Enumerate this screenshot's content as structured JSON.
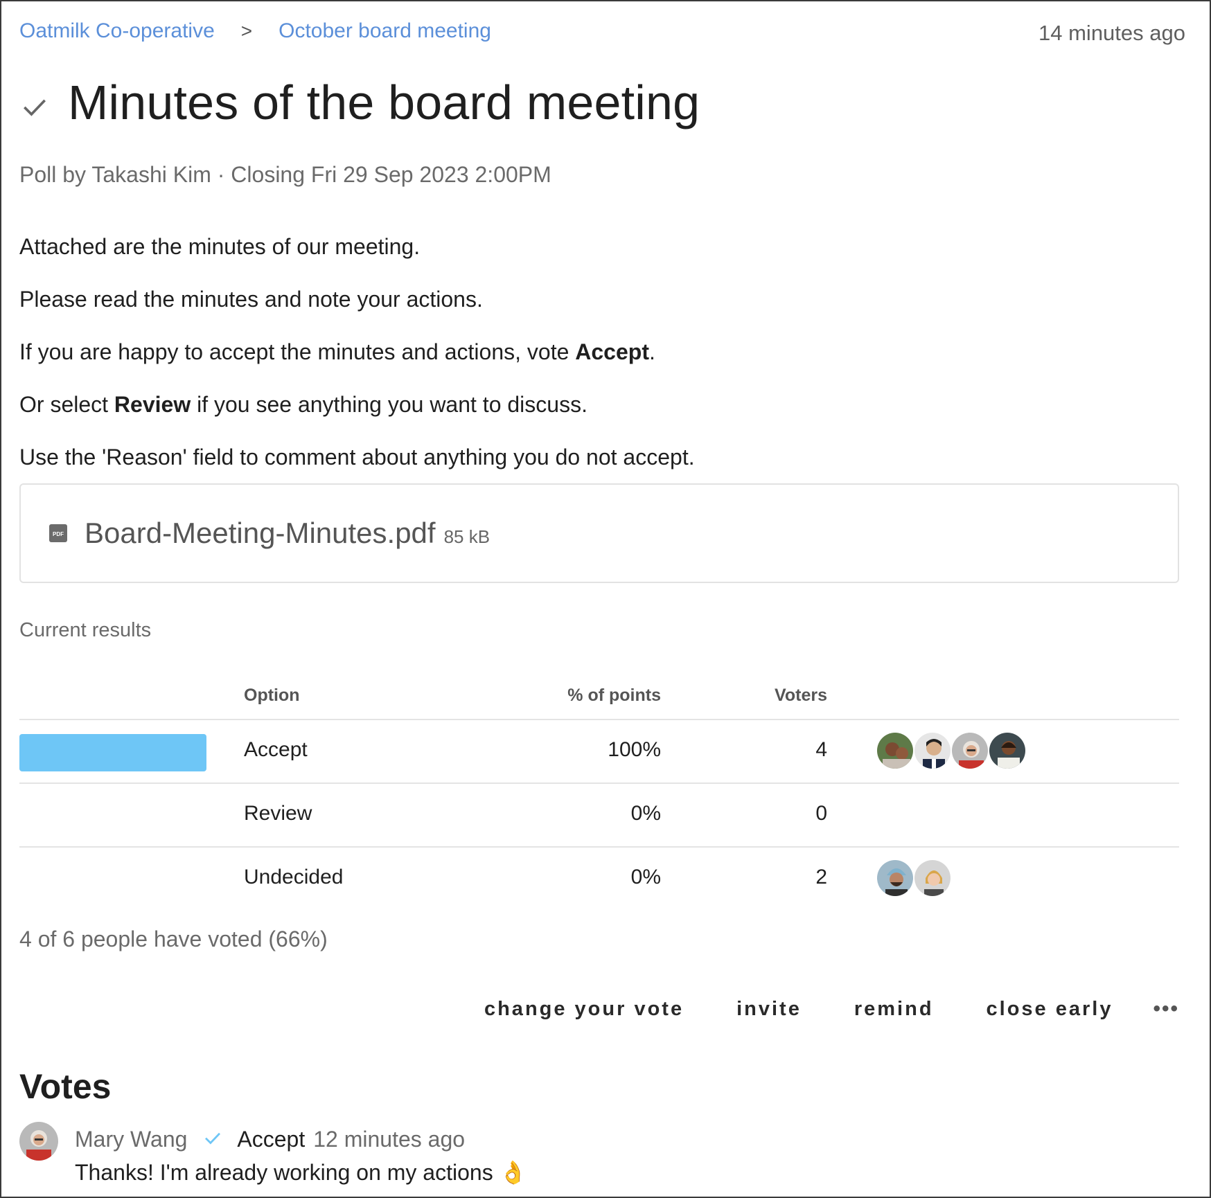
{
  "breadcrumb": {
    "group": "Oatmilk Co-operative",
    "separator": ">",
    "thread": "October board meeting"
  },
  "header": {
    "time_ago": "14 minutes ago",
    "title": "Minutes of the board meeting"
  },
  "meta": {
    "author_line": "Poll by Takashi Kim · Closing Fri 29 Sep 2023 2:00PM"
  },
  "body": {
    "p1": "Attached are the minutes of our meeting.",
    "p2": "Please read the minutes and note your actions.",
    "p3_pre": "If you are happy to accept the minutes and actions, vote ",
    "p3_bold": "Accept",
    "p3_post": ".",
    "p4_pre": "Or select ",
    "p4_bold": "Review",
    "p4_post": " if you see anything you want to discuss.",
    "p5": "Use the 'Reason' field to comment about anything you do not accept."
  },
  "attachment": {
    "icon": "pdf-icon",
    "name": "Board-Meeting-Minutes.pdf",
    "size": "85 kB"
  },
  "results": {
    "label": "Current results",
    "headers": {
      "option": "Option",
      "percent": "% of points",
      "voters": "Voters"
    },
    "rows": [
      {
        "option": "Accept",
        "percent": "100%",
        "voters": "4",
        "share": 1.0,
        "bar_color": "#6ec6f6",
        "avatar_count": 4
      },
      {
        "option": "Review",
        "percent": "0%",
        "voters": "0",
        "share": 0.0,
        "bar_color": "#6ec6f6",
        "avatar_count": 0
      },
      {
        "option": "Undecided",
        "percent": "0%",
        "voters": "2",
        "share": 0.0,
        "bar_color": "#6ec6f6",
        "avatar_count": 2
      }
    ],
    "summary": "4 of 6 people have voted (66%)"
  },
  "actions": {
    "change_vote": "change your vote",
    "invite": "invite",
    "remind": "remind",
    "close_early": "close early",
    "more": "•••"
  },
  "votes": {
    "title": "Votes",
    "items": [
      {
        "name": "Mary Wang",
        "choice": "Accept",
        "time": "12 minutes ago",
        "reason": "Thanks! I'm already working on my actions 👌"
      }
    ]
  },
  "colors": {
    "link": "#5b8fd9",
    "bar": "#6ec6f6",
    "check_blue": "#6ec6f6"
  }
}
